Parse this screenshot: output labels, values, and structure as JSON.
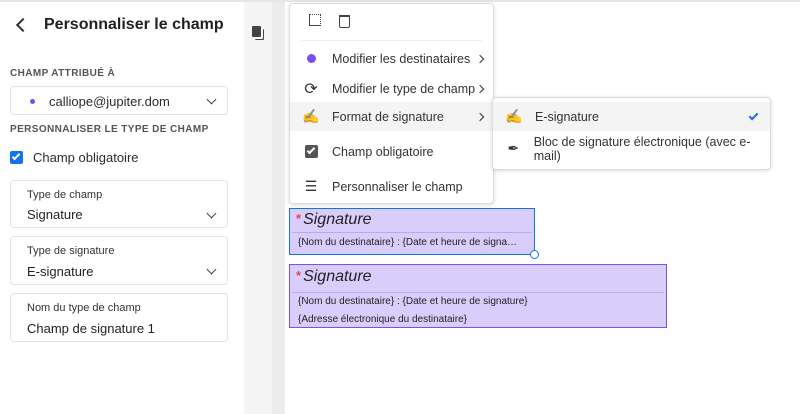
{
  "panel": {
    "title": "Personnaliser le champ",
    "assigned_label": "CHAMP ATTRIBUÉ À",
    "assigned_value": "calliope@jupiter.dom",
    "customize_label": "PERSONNALISER LE TYPE DE CHAMP",
    "required_label": "Champ obligatoire",
    "required_checked": true,
    "field_type": {
      "label": "Type de champ",
      "value": "Signature"
    },
    "signature_type": {
      "label": "Type de signature",
      "value": "E-signature"
    },
    "field_name": {
      "label": "Nom du type de champ",
      "value": "Champ de signature 1"
    }
  },
  "colors": {
    "recipient": "#7a4ff0",
    "accent": "#1473e6",
    "field_bg": "#d8cdfb"
  },
  "menu": {
    "items": [
      "Modifier les destinataires",
      "Modifier le type de champ",
      "Format de signature",
      "Champ obligatoire",
      "Personnaliser le champ"
    ]
  },
  "submenu": {
    "items": [
      "E-signature",
      "Bloc de signature électronique (avec e-mail)"
    ],
    "selected": 0
  },
  "fields": [
    {
      "title": "Signature",
      "lines": [
        "{Nom du destinataire} : {Date et heure de signa…"
      ]
    },
    {
      "title": "Signature",
      "lines": [
        "{Nom du destinataire} : {Date et heure de signature}",
        "{Adresse électronique du destinataire}"
      ]
    }
  ]
}
